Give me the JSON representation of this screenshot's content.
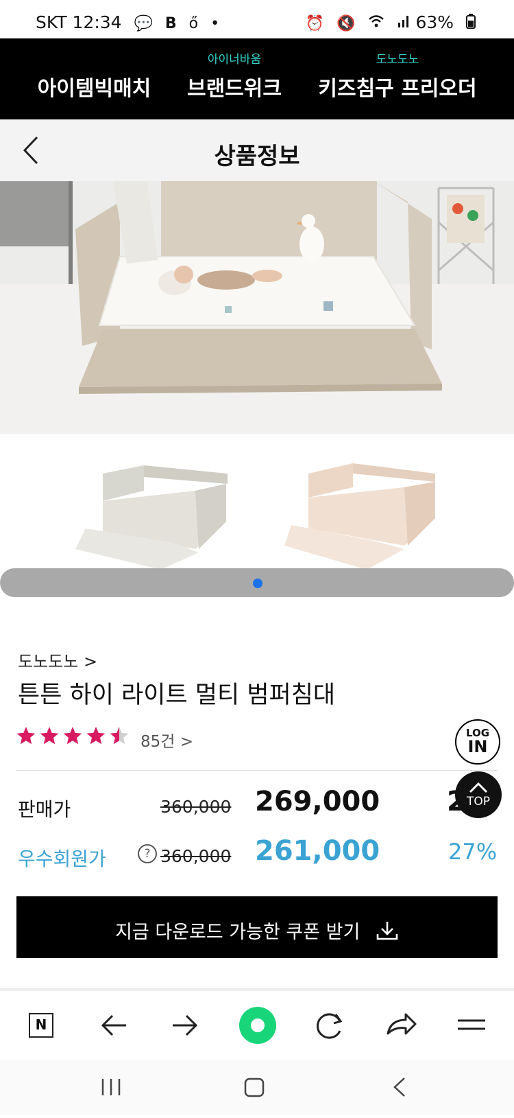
{
  "status_bar": {
    "carrier_time": "SKT 12:34",
    "battery": "63%",
    "icons": [
      "chat-bubble-icon",
      "b-app-icon",
      "notification-icon",
      "dot-icon",
      "alarm-icon",
      "mute-icon",
      "wifi-icon",
      "signal-icon",
      "battery-icon"
    ]
  },
  "top_nav": {
    "items": [
      {
        "sub": "",
        "label": "아이템빅매치"
      },
      {
        "sub": "아이너바움",
        "label": "브랜드위크"
      },
      {
        "sub": "도노도노",
        "label": "키즈침구 프리오더"
      }
    ],
    "accent_color": "#31d3c8"
  },
  "header": {
    "title": "상품정보"
  },
  "product": {
    "brand": "도노도노 >",
    "name": "튼튼 하이 라이트 멀티 범퍼침대",
    "rating": 4.5,
    "review_count": "85건 >",
    "sale_label": "판매가",
    "sale_original": "360,000",
    "sale_price": "269,000",
    "sale_extra": "2",
    "member_label": "우수회원가",
    "member_help": "?",
    "member_original": "360,000",
    "member_price": "261,000",
    "member_rate": "27%",
    "accent_color": "#3aa3d3"
  },
  "floating": {
    "login_line1": "LOG",
    "login_line2": "IN",
    "top_label": "TOP"
  },
  "coupon": {
    "label": "지금 다운로드 가능한 쿠폰 받기"
  },
  "browser_toolbar": {
    "home_label": "N",
    "icons": [
      "naver-home-icon",
      "back-arrow-icon",
      "forward-arrow-icon",
      "green-dot-icon",
      "refresh-icon",
      "share-icon",
      "menu-icon"
    ]
  },
  "system_nav": {
    "icons": [
      "recent-apps-icon",
      "home-icon",
      "back-icon"
    ]
  }
}
